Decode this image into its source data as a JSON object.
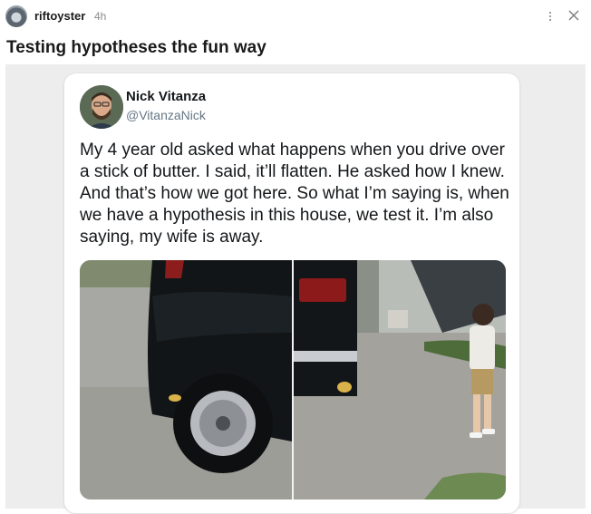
{
  "post": {
    "username": "riftoyster",
    "time": "4h",
    "title": "Testing hypotheses the fun way"
  },
  "tweet": {
    "name": "Nick Vitanza",
    "handle": "@VitanzaNick",
    "text": "My 4 year old asked what happens when you drive over a stick of butter. I said, it’ll flatten. He asked how I knew. And that’s how we got here. So what I’m saying is, when we have a hypothesis in this house, we test it. I’m also saying, my wife is away."
  },
  "icons": {
    "avatar": "user-avatar-icon",
    "more": "more-options-icon",
    "close": "close-icon"
  }
}
